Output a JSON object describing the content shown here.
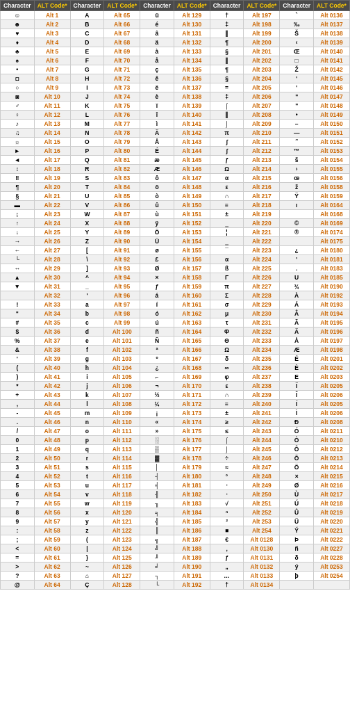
{
  "table": {
    "headers": [
      "Character",
      "ALT Code*",
      "Character",
      "ALT Code*",
      "Character",
      "ALT Code*",
      "Character",
      "ALT Code*",
      "Character",
      "ALT Code*"
    ],
    "rows": [
      [
        "☺",
        "Alt 1",
        "A",
        "Alt 65",
        "ü",
        "Alt 129",
        "†",
        "Alt 197",
        "ˋ",
        "Alt 0136"
      ],
      [
        "☻",
        "Alt 2",
        "B",
        "Alt 66",
        "é",
        "Alt 130",
        "‡",
        "Alt 198",
        "‰",
        "Alt 0137"
      ],
      [
        "♥",
        "Alt 3",
        "C",
        "Alt 67",
        "â",
        "Alt 131",
        "‖",
        "Alt 199",
        "Š",
        "Alt 0138"
      ],
      [
        "♦",
        "Alt 4",
        "D",
        "Alt 68",
        "ä",
        "Alt 132",
        "¶",
        "Alt 200",
        "‹",
        "Alt 0139"
      ],
      [
        "♣",
        "Alt 5",
        "E",
        "Alt 69",
        "à",
        "Alt 133",
        "§",
        "Alt 201",
        "Œ",
        "Alt 0140"
      ],
      [
        "♠",
        "Alt 6",
        "F",
        "Alt 70",
        "å",
        "Alt 134",
        "‖",
        "Alt 202",
        "□",
        "Alt 0141"
      ],
      [
        "•",
        "Alt 7",
        "G",
        "Alt 71",
        "ç",
        "Alt 135",
        "¶",
        "Alt 203",
        "Ž",
        "Alt 0142"
      ],
      [
        "◘",
        "Alt 8",
        "H",
        "Alt 72",
        "ê",
        "Alt 136",
        "§",
        "Alt 204",
        "'",
        "Alt 0145"
      ],
      [
        "○",
        "Alt 9",
        "I",
        "Alt 73",
        "ë",
        "Alt 137",
        "=",
        "Alt 205",
        "'",
        "Alt 0146"
      ],
      [
        "◙",
        "Alt 10",
        "J",
        "Alt 74",
        "è",
        "Alt 138",
        "‡",
        "Alt 206",
        "\"",
        "Alt 0147"
      ],
      [
        "♂",
        "Alt 11",
        "K",
        "Alt 75",
        "ï",
        "Alt 139",
        "⌠",
        "Alt 207",
        "\"",
        "Alt 0148"
      ],
      [
        "♀",
        "Alt 12",
        "L",
        "Alt 76",
        "î",
        "Alt 140",
        "‖",
        "Alt 208",
        "•",
        "Alt 0149"
      ],
      [
        "♪",
        "Alt 13",
        "M",
        "Alt 77",
        "ì",
        "Alt 141",
        "⌡",
        "Alt 209",
        "–",
        "Alt 0150"
      ],
      [
        "♫",
        "Alt 14",
        "N",
        "Alt 78",
        "Ä",
        "Alt 142",
        "π",
        "Alt 210",
        "—",
        "Alt 0151"
      ],
      [
        "☼",
        "Alt 15",
        "O",
        "Alt 79",
        "Å",
        "Alt 143",
        "∫",
        "Alt 211",
        "˜",
        "Alt 0152"
      ],
      [
        "►",
        "Alt 16",
        "P",
        "Alt 80",
        "É",
        "Alt 144",
        "∫",
        "Alt 212",
        "™",
        "Alt 0153"
      ],
      [
        "◄",
        "Alt 17",
        "Q",
        "Alt 81",
        "æ",
        "Alt 145",
        "ƒ",
        "Alt 213",
        "š",
        "Alt 0154"
      ],
      [
        "↕",
        "Alt 18",
        "R",
        "Alt 82",
        "Æ",
        "Alt 146",
        "Ω",
        "Alt 214",
        "›",
        "Alt 0155"
      ],
      [
        "‼",
        "Alt 19",
        "S",
        "Alt 83",
        "ô",
        "Alt 147",
        "α",
        "Alt 215",
        "œ",
        "Alt 0156"
      ],
      [
        "¶",
        "Alt 20",
        "T",
        "Alt 84",
        "ö",
        "Alt 148",
        "ε",
        "Alt 216",
        "ž",
        "Alt 0158"
      ],
      [
        "§",
        "Alt 21",
        "U",
        "Alt 85",
        "ò",
        "Alt 149",
        "∩",
        "Alt 217",
        "Ÿ",
        "Alt 0159"
      ],
      [
        "▬",
        "Alt 22",
        "V",
        "Alt 86",
        "û",
        "Alt 150",
        "≡",
        "Alt 218",
        "ı",
        "Alt 0164"
      ],
      [
        "↨",
        "Alt 23",
        "W",
        "Alt 87",
        "ù",
        "Alt 151",
        "±",
        "Alt 219",
        "",
        "Alt 0168"
      ],
      [
        "↑",
        "Alt 24",
        "X",
        "Alt 88",
        "ÿ",
        "Alt 152",
        "‗",
        "Alt 220",
        "©",
        "Alt 0169"
      ],
      [
        "↓",
        "Alt 25",
        "Y",
        "Alt 89",
        "Ö",
        "Alt 153",
        "¦",
        "Alt 221",
        "®",
        "Alt 0174"
      ],
      [
        "→",
        "Alt 26",
        "Z",
        "Alt 90",
        "Ü",
        "Alt 154",
        "‗",
        "Alt 222",
        "",
        "Alt 0175"
      ],
      [
        "←",
        "Alt 27",
        "[",
        "Alt 91",
        "ø",
        "Alt 155",
        "¯",
        "Alt 223",
        "¿",
        "Alt 0180"
      ],
      [
        "└",
        "Alt 28",
        "\\",
        "Alt 92",
        "£",
        "Alt 156",
        "α",
        "Alt 224",
        "'",
        "Alt 0181"
      ],
      [
        "↔",
        "Alt 29",
        "]",
        "Alt 93",
        "Ø",
        "Alt 157",
        "ß",
        "Alt 225",
        ".",
        "Alt 0183"
      ],
      [
        "▲",
        "Alt 30",
        "^",
        "Alt 94",
        "×",
        "Alt 158",
        "Γ",
        "Alt 226",
        "U",
        "Alt 0185"
      ],
      [
        "▼",
        "Alt 31",
        "_",
        "Alt 95",
        "ƒ",
        "Alt 159",
        "π",
        "Alt 227",
        "¾",
        "Alt 0190"
      ],
      [
        "",
        "Alt 32",
        "'",
        "Alt 96",
        "á",
        "Alt 160",
        "Σ",
        "Alt 228",
        "À",
        "Alt 0192"
      ],
      [
        "!",
        "Alt 33",
        "a",
        "Alt 97",
        "í",
        "Alt 161",
        "σ",
        "Alt 229",
        "Á",
        "Alt 0193"
      ],
      [
        "\"",
        "Alt 34",
        "b",
        "Alt 98",
        "ó",
        "Alt 162",
        "μ",
        "Alt 230",
        "Â",
        "Alt 0194"
      ],
      [
        "#",
        "Alt 35",
        "c",
        "Alt 99",
        "ú",
        "Alt 163",
        "τ",
        "Alt 231",
        "Ã",
        "Alt 0195"
      ],
      [
        "$",
        "Alt 36",
        "d",
        "Alt 100",
        "ñ",
        "Alt 164",
        "Φ",
        "Alt 232",
        "Ä",
        "Alt 0196"
      ],
      [
        "%",
        "Alt 37",
        "e",
        "Alt 101",
        "Ñ",
        "Alt 165",
        "Θ",
        "Alt 233",
        "Å",
        "Alt 0197"
      ],
      [
        "&",
        "Alt 38",
        "f",
        "Alt 102",
        "ª",
        "Alt 166",
        "Ω",
        "Alt 234",
        "Æ",
        "Alt 0198"
      ],
      [
        "'",
        "Alt 39",
        "g",
        "Alt 103",
        "º",
        "Alt 167",
        "δ",
        "Alt 235",
        "É",
        "Alt 0201"
      ],
      [
        "(",
        "Alt 40",
        "h",
        "Alt 104",
        "¿",
        "Alt 168",
        "∞",
        "Alt 236",
        "È",
        "Alt 0202"
      ],
      [
        ")",
        "Alt 41",
        "i",
        "Alt 105",
        "⌐",
        "Alt 169",
        "φ",
        "Alt 237",
        "E",
        "Alt 0203"
      ],
      [
        "*",
        "Alt 42",
        "j",
        "Alt 106",
        "¬",
        "Alt 170",
        "ε",
        "Alt 238",
        "Ï",
        "Alt 0205"
      ],
      [
        "+",
        "Alt 43",
        "k",
        "Alt 107",
        "½",
        "Alt 171",
        "∩",
        "Alt 239",
        "Î",
        "Alt 0206"
      ],
      [
        ",",
        "Alt 44",
        "l",
        "Alt 108",
        "¼",
        "Alt 172",
        "≡",
        "Alt 240",
        "Í",
        "Alt 0205"
      ],
      [
        "-",
        "Alt 45",
        "m",
        "Alt 109",
        "¡",
        "Alt 173",
        "±",
        "Alt 241",
        "Ì",
        "Alt 0206"
      ],
      [
        ".",
        "Alt 46",
        "n",
        "Alt 110",
        "«",
        "Alt 174",
        "≥",
        "Alt 242",
        "Ð",
        "Alt 0208"
      ],
      [
        "/",
        "Alt 47",
        "o",
        "Alt 111",
        "»",
        "Alt 175",
        "≤",
        "Alt 243",
        "Ó",
        "Alt 0211"
      ],
      [
        "0",
        "Alt 48",
        "p",
        "Alt 112",
        "░",
        "Alt 176",
        "⌠",
        "Alt 244",
        "Ò",
        "Alt 0210"
      ],
      [
        "1",
        "Alt 49",
        "q",
        "Alt 113",
        "▒",
        "Alt 177",
        "⌡",
        "Alt 245",
        "Ô",
        "Alt 0212"
      ],
      [
        "2",
        "Alt 50",
        "r",
        "Alt 114",
        "▓",
        "Alt 178",
        "÷",
        "Alt 246",
        "Õ",
        "Alt 0213"
      ],
      [
        "3",
        "Alt 51",
        "s",
        "Alt 115",
        "│",
        "Alt 179",
        "≈",
        "Alt 247",
        "Ö",
        "Alt 0214"
      ],
      [
        "4",
        "Alt 52",
        "t",
        "Alt 116",
        "┤",
        "Alt 180",
        "°",
        "Alt 248",
        "×",
        "Alt 0215"
      ],
      [
        "5",
        "Alt 53",
        "u",
        "Alt 117",
        "╡",
        "Alt 181",
        "∙",
        "Alt 249",
        "Ø",
        "Alt 0216"
      ],
      [
        "6",
        "Alt 54",
        "v",
        "Alt 118",
        "╢",
        "Alt 182",
        "·",
        "Alt 250",
        "Ù",
        "Alt 0217"
      ],
      [
        "7",
        "Alt 55",
        "w",
        "Alt 119",
        "╖",
        "Alt 183",
        "√",
        "Alt 251",
        "Ú",
        "Alt 0218"
      ],
      [
        "8",
        "Alt 56",
        "x",
        "Alt 120",
        "╕",
        "Alt 184",
        "ⁿ",
        "Alt 252",
        "Û",
        "Alt 0219"
      ],
      [
        "9",
        "Alt 57",
        "y",
        "Alt 121",
        "╣",
        "Alt 185",
        "²",
        "Alt 253",
        "Ü",
        "Alt 0220"
      ],
      [
        ":",
        "Alt 58",
        "z",
        "Alt 122",
        "║",
        "Alt 186",
        "■",
        "Alt 254",
        "Ý",
        "Alt 0221"
      ],
      [
        ";",
        "Alt 59",
        "(",
        "Alt 123",
        "╗",
        "Alt 187",
        "€",
        "Alt 0128",
        "Þ",
        "Alt 0222"
      ],
      [
        "<",
        "Alt 60",
        "|",
        "Alt 124",
        "╝",
        "Alt 188",
        "‚",
        "Alt 0130",
        "ñ",
        "Alt 0227"
      ],
      [
        "=",
        "Alt 61",
        "}",
        "Alt 125",
        "╜",
        "Alt 189",
        "ƒ",
        "Alt 0131",
        "δ",
        "Alt 0228"
      ],
      [
        ">",
        "Alt 62",
        "~",
        "Alt 126",
        "╛",
        "Alt 190",
        "„",
        "Alt 0132",
        "ý",
        "Alt 0253"
      ],
      [
        "?",
        "Alt 63",
        "⌂",
        "Alt 127",
        "┐",
        "Alt 191",
        "…",
        "Alt 0133",
        "þ",
        "Alt 0254"
      ],
      [
        "@",
        "Alt 64",
        "Ç",
        "Alt 128",
        "└",
        "Alt 192",
        "†",
        "Alt 0134",
        "",
        ""
      ]
    ]
  }
}
